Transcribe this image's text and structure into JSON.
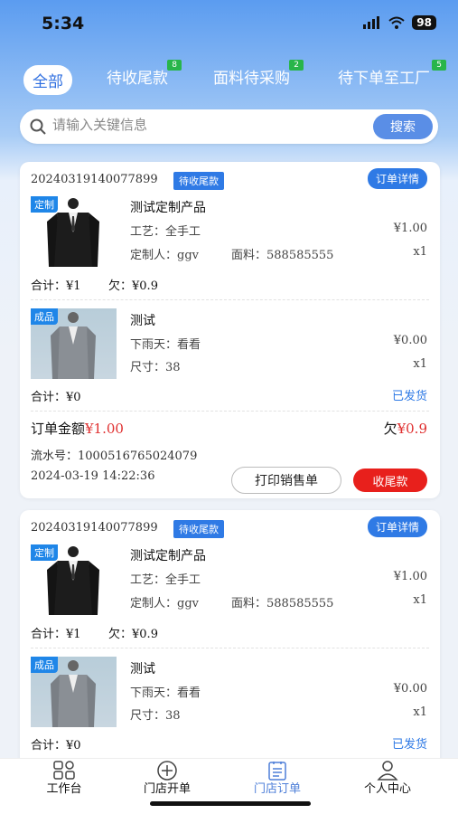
{
  "status_bar": {
    "time": "5:34",
    "battery": "98"
  },
  "tabs": [
    {
      "label": "全部",
      "badge": null
    },
    {
      "label": "待收尾款",
      "badge": "8"
    },
    {
      "label": "面料待采购",
      "badge": "2"
    },
    {
      "label": "待下单至工厂",
      "badge": "5"
    }
  ],
  "search": {
    "placeholder": "请输入关键信息",
    "button": "搜索"
  },
  "orders": [
    {
      "order_no": "20240319140077899",
      "status": "待收尾款",
      "detail_button": "订单详情",
      "items": [
        {
          "tag": "定制",
          "name": "测试定制产品",
          "line1_label": "工艺：",
          "line1_value": "全手工",
          "line2_label": "定制人：",
          "line2_value": "ggv",
          "line2b_label": "面料：",
          "line2b_value": "588585555",
          "price": "¥1.00",
          "qty": "x1",
          "sum_label": "合计：",
          "sum_value": "¥1",
          "owe_label": "欠：",
          "owe_value": "¥0.9",
          "shipped": ""
        },
        {
          "tag": "成品",
          "name": "测试",
          "line1_label": "下雨天：",
          "line1_value": "看看",
          "line2_label": "尺寸：",
          "line2_value": "38",
          "price": "¥0.00",
          "qty": "x1",
          "sum_label": "合计：",
          "sum_value": "¥0",
          "shipped": "已发货"
        }
      ],
      "total_label": "订单金额",
      "total_value": "¥1.00",
      "owe_label": "欠",
      "owe_value": "¥0.9",
      "serial_label": "流水号：",
      "serial_value": "1000516765024079",
      "datetime": "2024-03-19 14:22:36",
      "print_button": "打印销售单",
      "collect_button": "收尾款"
    },
    {
      "order_no": "20240319140077899",
      "status": "待收尾款",
      "detail_button": "订单详情",
      "items": [
        {
          "tag": "定制",
          "name": "测试定制产品",
          "line1_label": "工艺：",
          "line1_value": "全手工",
          "line2_label": "定制人：",
          "line2_value": "ggv",
          "line2b_label": "面料：",
          "line2b_value": "588585555",
          "price": "¥1.00",
          "qty": "x1",
          "sum_label": "合计：",
          "sum_value": "¥1",
          "owe_label": "欠：",
          "owe_value": "¥0.9"
        },
        {
          "tag": "成品",
          "name": "测试",
          "line1_label": "下雨天：",
          "line1_value": "看看",
          "line2_label": "尺寸：",
          "line2_value": "38",
          "price": "¥0.00",
          "qty": "x1",
          "sum_label": "合计：",
          "sum_value": "¥0",
          "shipped": "已发货"
        }
      ]
    }
  ],
  "bottom_nav": [
    {
      "label": "工作台",
      "icon": "grid-icon"
    },
    {
      "label": "门店开单",
      "icon": "plus-circle-icon"
    },
    {
      "label": "门店订单",
      "icon": "clipboard-icon",
      "active": true
    },
    {
      "label": "个人中心",
      "icon": "person-icon"
    }
  ],
  "colors": {
    "accent": "#2f7ae5",
    "danger": "#e8201c",
    "badge": "#28b54a"
  }
}
